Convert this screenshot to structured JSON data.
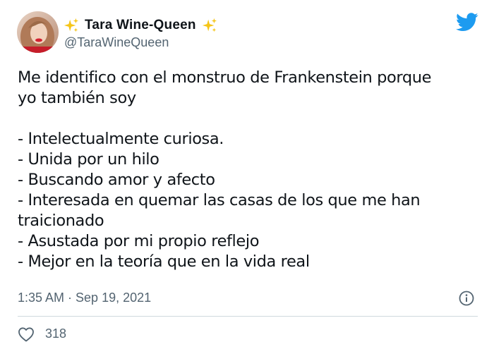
{
  "author": {
    "display_name": "Tara Wine-Queen",
    "handle": "@TaraWineQueen",
    "name_emoji": "sparkles-icon"
  },
  "tweet": {
    "intro_line1": "Me identifico con el monstruo de Frankenstein porque",
    "intro_line2": "yo también soy",
    "list_lines": [
      "- Intelectualmente curiosa.",
      "- Unida por un hilo",
      "- Buscando amor y afecto",
      "- Interesada en quemar las casas de los que me han",
      "traicionado",
      "- Asustada por mi propio reflejo",
      "- Mejor en la teoría que en la vida real"
    ],
    "timestamp": "1:35 AM · Sep 19, 2021"
  },
  "engagement": {
    "likes": "318"
  },
  "colors": {
    "twitter_blue": "#1d9bf0",
    "sparkle_yellow": "#f5c518",
    "secondary_text": "#536471"
  }
}
